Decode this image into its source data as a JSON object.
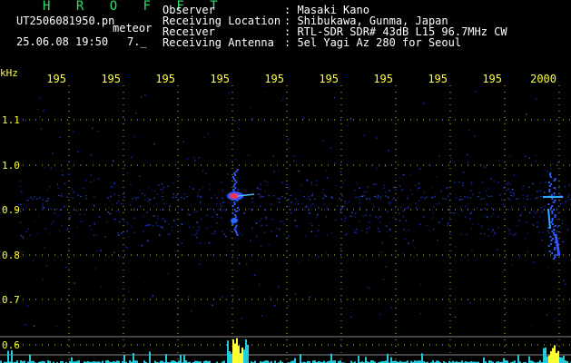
{
  "header": {
    "brand": "H R O F F T",
    "filename": "UT2506081950.pn",
    "tag": "meteor",
    "datetime": "25.06.08 19:50",
    "frame": "7._",
    "info": [
      {
        "label": "Observer",
        "value": ": Masaki Kano"
      },
      {
        "label": "Receiving Location",
        "value": ": Shibukawa, Gunma, Japan"
      },
      {
        "label": "Receiver",
        "value": ": RTL-SDR SDR# 43dB L15 96.7MHz CW"
      },
      {
        "label": "Receiving Antenna",
        "value": ": 5el Yagi Az 280 for Seoul"
      }
    ]
  },
  "axis": {
    "y_unit": "kHz",
    "y_ticks": [
      "1.1",
      "1.0",
      "0.9",
      "0.8",
      "0.7",
      "0.6"
    ],
    "x_ticks": [
      "195",
      "195",
      "195",
      "195",
      "195",
      "195",
      "195",
      "195",
      "195",
      "2000"
    ]
  },
  "colors": {
    "accent": "#ffff33",
    "brand": "#2ee06a",
    "signal_blue": "#2a5cff",
    "signal_red": "#ff3355",
    "spectrum_cyan": "#22ccdd"
  }
}
